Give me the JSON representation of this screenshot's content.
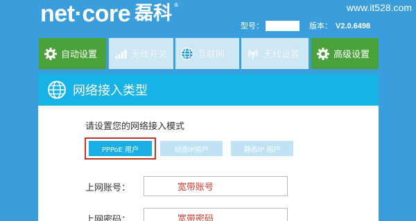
{
  "header": {
    "logo_text": "net·core",
    "logo_cn": "磊科",
    "logo_mark": "®",
    "watermark": "www.it528.com",
    "model_label": "型号：",
    "model_value": "",
    "version_label": "版本：",
    "version_value": "V2.0.6498"
  },
  "nav": {
    "tabs": [
      {
        "label": "自动设置",
        "icon": "gear-icon",
        "state": "active-green"
      },
      {
        "label": "无线开关",
        "icon": "signal-bars-icon",
        "state": "light"
      },
      {
        "label": "互联网",
        "icon": "globe-icon",
        "state": "light"
      },
      {
        "label": "无线设置",
        "icon": "wireless-antenna-icon",
        "state": "light"
      },
      {
        "label": "高级设置",
        "icon": "gear-icon",
        "state": "active-green"
      }
    ]
  },
  "section": {
    "title": "网络接入类型",
    "icon": "globe-icon"
  },
  "content": {
    "prompt": "请设置您的网络接入模式",
    "modes": [
      {
        "label": "PPPoE 用户",
        "selected": true
      },
      {
        "label": "动态IP用户",
        "selected": false
      },
      {
        "label": "静态IP 用户",
        "selected": false
      }
    ],
    "account_label": "上网账号：",
    "account_value": "宽带账号",
    "password_label": "上网密码：",
    "password_value": "宽带密码"
  },
  "colors": {
    "background": "#3a9edc",
    "green_tab": "#4aa13a",
    "light_tab": "#cde7f5",
    "section_bar": "#17b2e6",
    "selected_mode": "#1ab0e6",
    "unselected_mode": "#bfe2f4",
    "highlight_box": "#c0332b",
    "input_text": "#d23a2c"
  }
}
